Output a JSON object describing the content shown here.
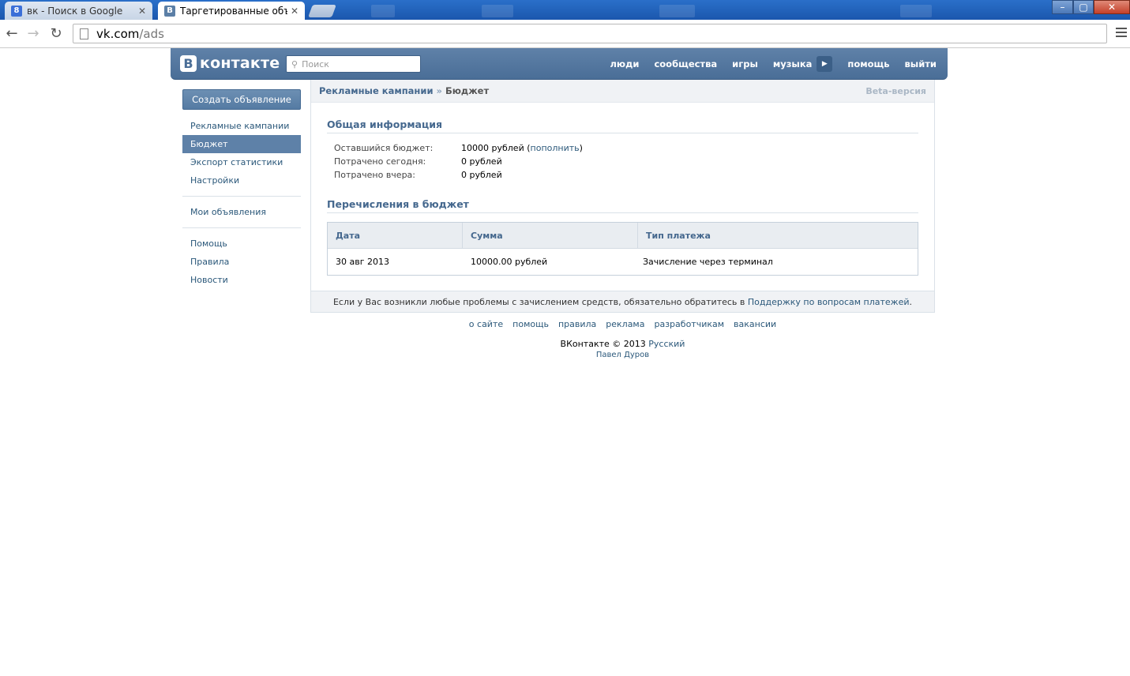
{
  "browser": {
    "tabs": [
      {
        "title": "вк - Поиск в Google",
        "favicon": "8",
        "favicon_color": "#3b6fd8",
        "active": false
      },
      {
        "title": "Таргетированные объяв/",
        "favicon": "B",
        "favicon_color": "#5b7fa6",
        "active": true
      }
    ],
    "url_host": "vk.com",
    "url_path": "/ads",
    "window_controls": {
      "minimize": "–",
      "maximize": "▢",
      "close": "✕"
    }
  },
  "header": {
    "logo_letter": "В",
    "logo_text": "контакте",
    "search_placeholder": "Поиск",
    "nav": [
      "люди",
      "сообщества",
      "игры",
      "музыка",
      "помощь",
      "выйти"
    ],
    "music_play_icon": "play-icon"
  },
  "sidebar": {
    "create_button": "Создать объявление",
    "groups": [
      [
        {
          "label": "Рекламные кампании",
          "selected": false
        },
        {
          "label": "Бюджет",
          "selected": true
        },
        {
          "label": "Экспорт статистики",
          "selected": false
        },
        {
          "label": "Настройки",
          "selected": false
        }
      ],
      [
        {
          "label": "Мои объявления",
          "selected": false
        }
      ],
      [
        {
          "label": "Помощь",
          "selected": false
        },
        {
          "label": "Правила",
          "selected": false
        },
        {
          "label": "Новости",
          "selected": false
        }
      ]
    ]
  },
  "content": {
    "breadcrumb_parent": "Рекламные кампании",
    "breadcrumb_sep": "»",
    "breadcrumb_current": "Бюджет",
    "beta_label": "Beta-версия",
    "general": {
      "title": "Общая информация",
      "remaining_label": "Оставшийся бюджет:",
      "remaining_value": "10000 рублей",
      "topup_link": "пополнить",
      "today_label": "Потрачено сегодня:",
      "today_value": "0 рублей",
      "yesterday_label": "Потрачено вчера:",
      "yesterday_value": "0 рублей"
    },
    "transfers": {
      "title": "Перечисления в бюджет",
      "columns": [
        "Дата",
        "Сумма",
        "Тип платежа"
      ],
      "rows": [
        [
          "30 авг 2013",
          "10000.00 рублей",
          "Зачисление через терминал"
        ]
      ]
    },
    "footer_note": "Если у Вас возникли любые проблемы с зачислением средств, обязательно обратитесь в",
    "footer_link": "Поддержку по вопросам платежей",
    "footer_end": "."
  },
  "footer": {
    "links": [
      "о сайте",
      "помощь",
      "правила",
      "реклама",
      "разработчикам",
      "вакансии"
    ],
    "copyright": "ВКонтакте © 2013",
    "language": "Русский",
    "author": "Павел Дуров"
  },
  "colors": {
    "brand": "#5e81a8",
    "link": "#2b587a",
    "heading": "#45688e"
  }
}
